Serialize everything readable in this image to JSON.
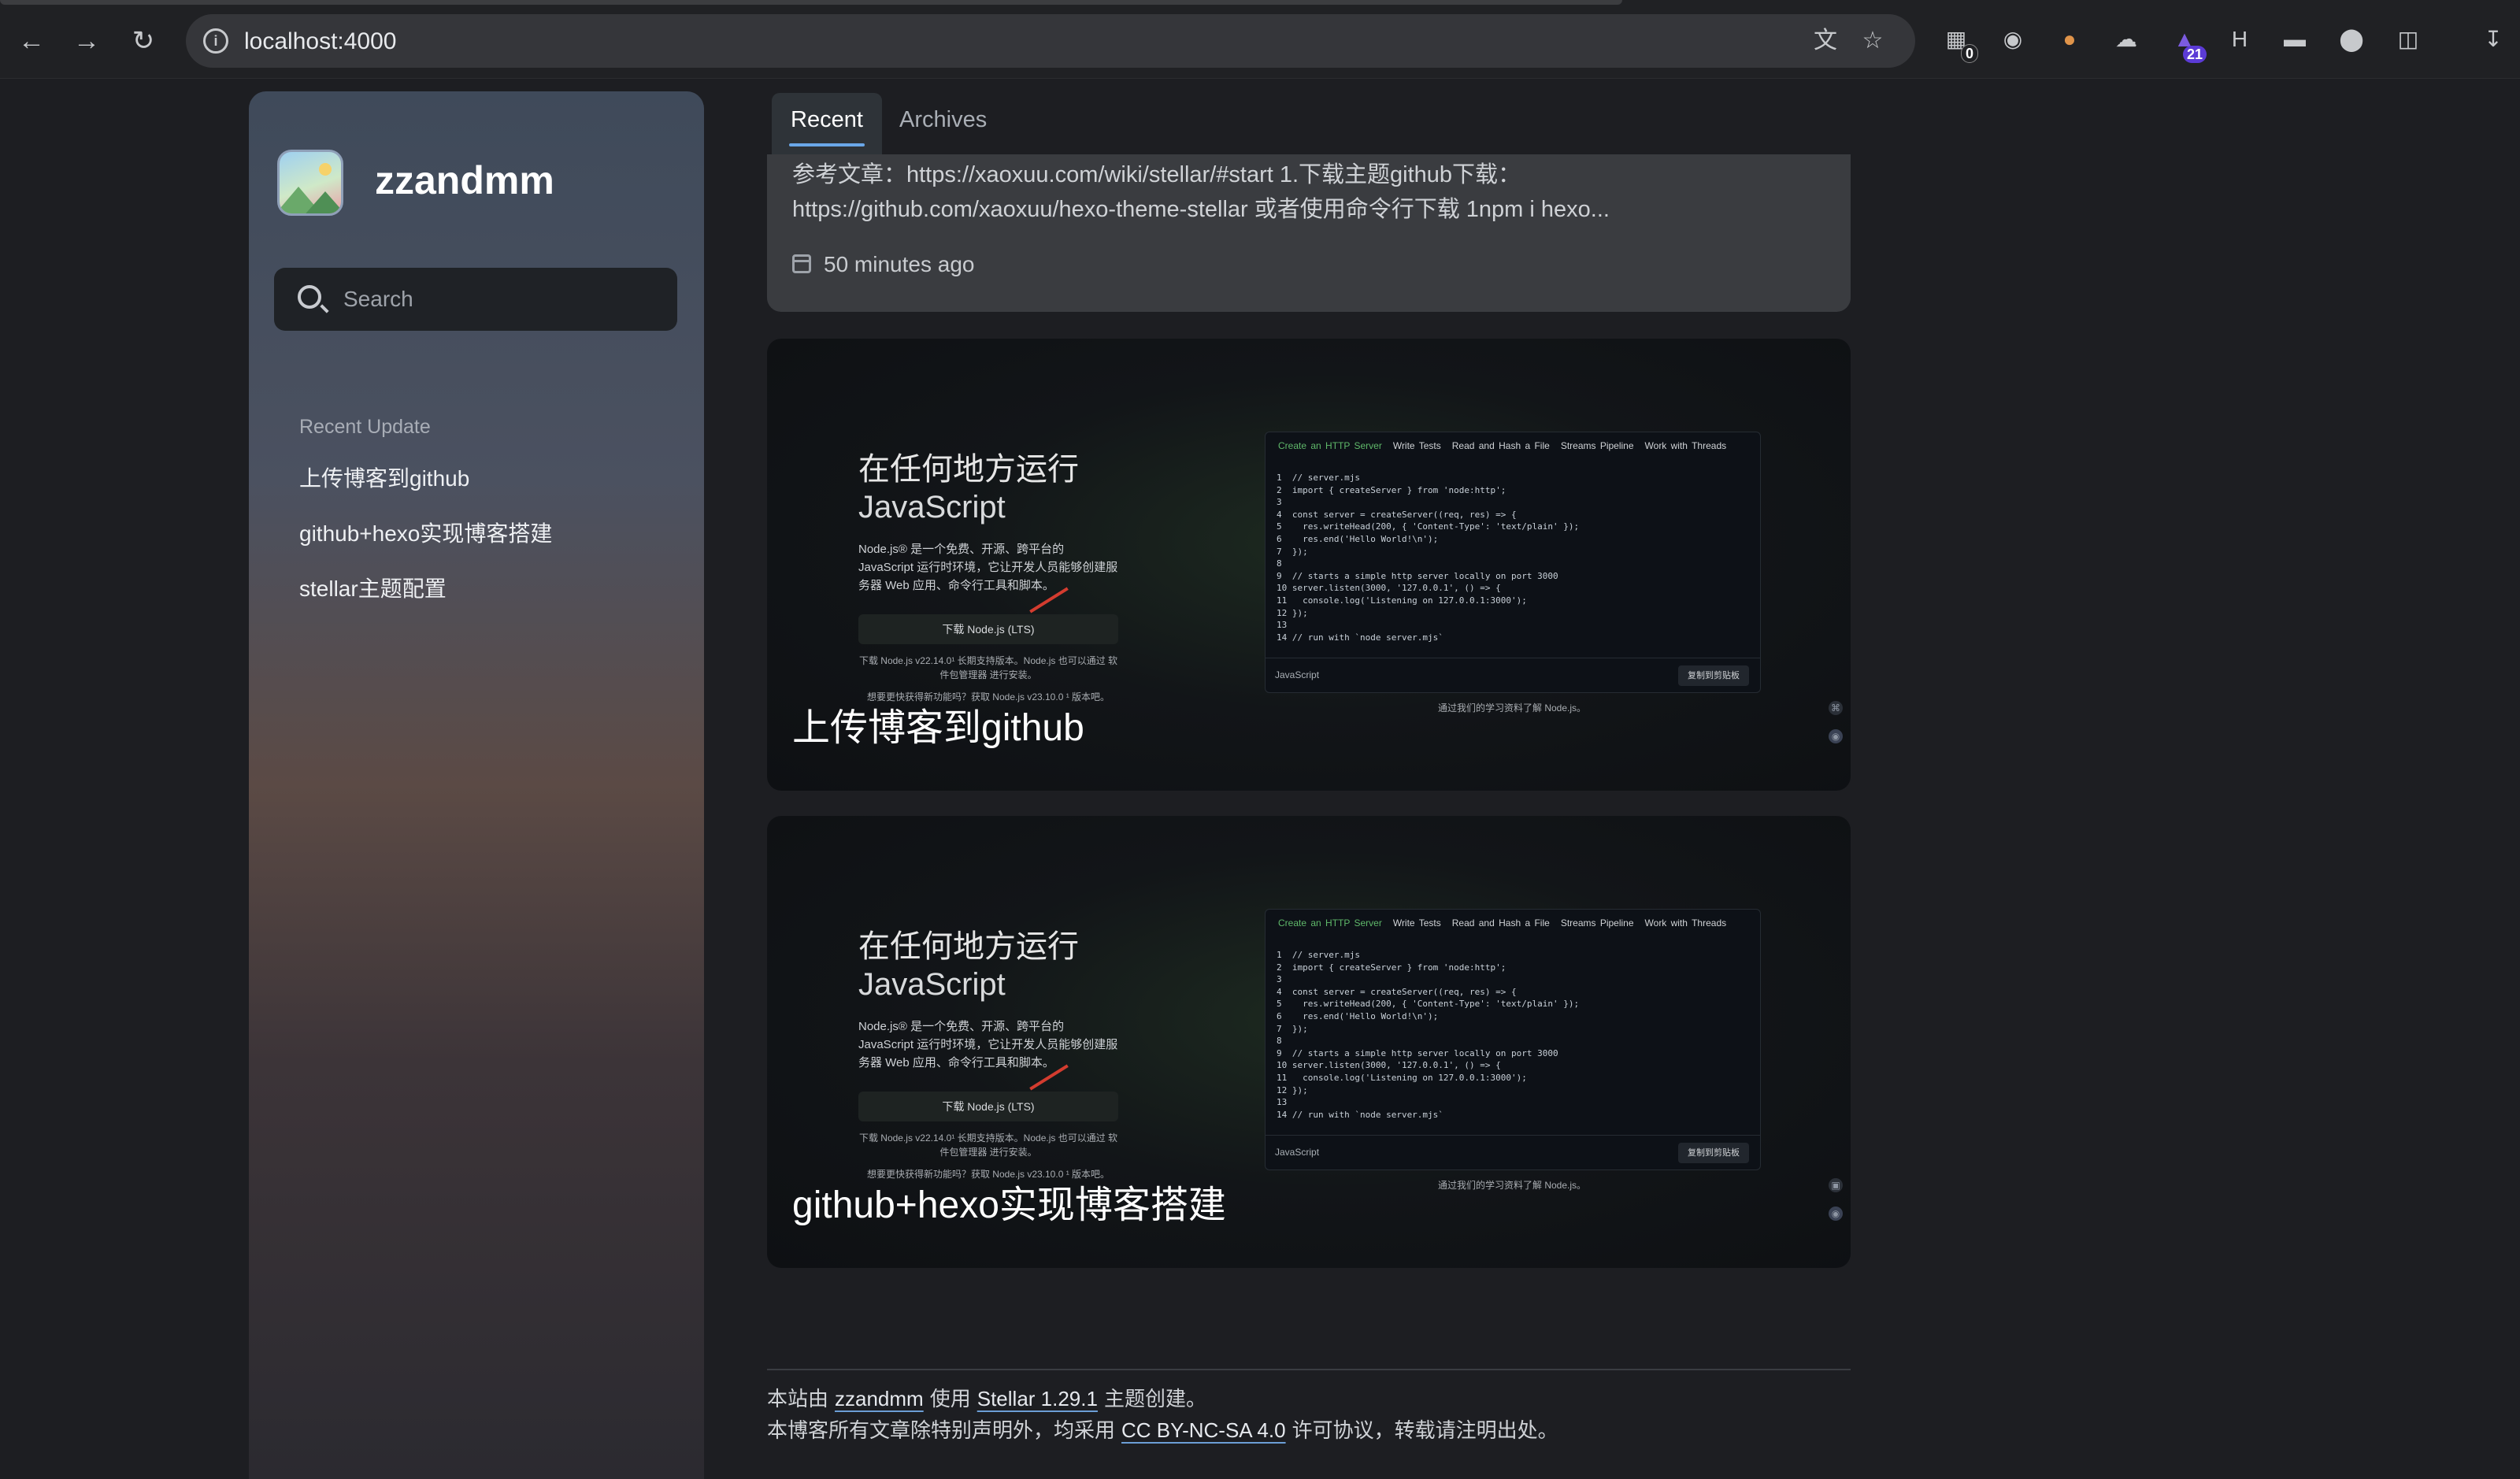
{
  "browser": {
    "url": "localhost:4000",
    "extension_badges": {
      "ext1": "0",
      "ext2": "21"
    }
  },
  "sidebar": {
    "site_name": "zzandmm",
    "search_placeholder": "Search",
    "recent_title": "Recent Update",
    "recent_items": [
      "上传博客到github",
      "github+hexo实现博客搭建",
      "stellar主题配置"
    ]
  },
  "tabs": [
    "Recent",
    "Archives"
  ],
  "post": {
    "excerpt_line1": "参考文章：https://xaoxuu.com/wiki/stellar/#start 1.下载主题github下载：",
    "excerpt_line2": "https://github.com/xaoxuu/hexo-theme-stellar 或者使用命令行下载 1npm i hexo...",
    "date": "50 minutes ago"
  },
  "cards": [
    {
      "title": "上传博客到github",
      "hero_line1": "在任何地方运行",
      "hero_line2": "JavaScript",
      "desc": "Node.js® 是一个免费、开源、跨平台的 JavaScript 运行时环境，它让开发人员能够创建服务器 Web 应用、命令行工具和脚本。",
      "download": "下载 Node.js (LTS)",
      "small1": "下载 Node.js v22.14.0¹ 长期支持版本。Node.js 也可以通过 软件包管理器 进行安装。",
      "small2": "想要更快获得新功能吗？获取 Node.js v23.10.0 ¹ 版本吧。",
      "code_tabs": [
        "Create an HTTP Server",
        "Write Tests",
        "Read and Hash a File",
        "Streams Pipeline",
        "Work with Threads"
      ],
      "code": "1  // server.mjs\n2  import { createServer } from 'node:http';\n3\n4  const server = createServer((req, res) => {\n5    res.writeHead(200, { 'Content-Type': 'text/plain' });\n6    res.end('Hello World!\\n');\n7  });\n8\n9  // starts a simple http server locally on port 3000\n10 server.listen(3000, '127.0.0.1', () => {\n11   console.log('Listening on 127.0.0.1:3000');\n12 });\n13\n14 // run with `node server.mjs`",
      "code_lang": "JavaScript",
      "copy": "复制到剪贴板",
      "learn": "通过我们的学习资料了解 Node.js。"
    },
    {
      "title": "github+hexo实现博客搭建",
      "hero_line1": "在任何地方运行",
      "hero_line2": "JavaScript",
      "desc": "Node.js® 是一个免费、开源、跨平台的 JavaScript 运行时环境，它让开发人员能够创建服务器 Web 应用、命令行工具和脚本。",
      "download": "下载 Node.js (LTS)",
      "small1": "下载 Node.js v22.14.0¹ 长期支持版本。Node.js 也可以通过 软件包管理器 进行安装。",
      "small2": "想要更快获得新功能吗？获取 Node.js v23.10.0 ¹ 版本吧。",
      "code_tabs": [
        "Create an HTTP Server",
        "Write Tests",
        "Read and Hash a File",
        "Streams Pipeline",
        "Work with Threads"
      ],
      "code": "1  // server.mjs\n2  import { createServer } from 'node:http';\n3\n4  const server = createServer((req, res) => {\n5    res.writeHead(200, { 'Content-Type': 'text/plain' });\n6    res.end('Hello World!\\n');\n7  });\n8\n9  // starts a simple http server locally on port 3000\n10 server.listen(3000, '127.0.0.1', () => {\n11   console.log('Listening on 127.0.0.1:3000');\n12 });\n13\n14 // run with `node server.mjs`",
      "code_lang": "JavaScript",
      "copy": "复制到剪贴板",
      "learn": "通过我们的学习资料了解 Node.js。"
    }
  ],
  "footer": {
    "line1_prefix": "本站由",
    "author": "zzandmm",
    "line1_mid": "使用",
    "theme": "Stellar 1.29.1",
    "line1_suffix": "主题创建。",
    "line2_prefix": "本博客所有文章除特别声明外，均采用",
    "license": "CC BY-NC-SA 4.0",
    "line2_suffix": "许可协议，转载请注明出处。"
  }
}
